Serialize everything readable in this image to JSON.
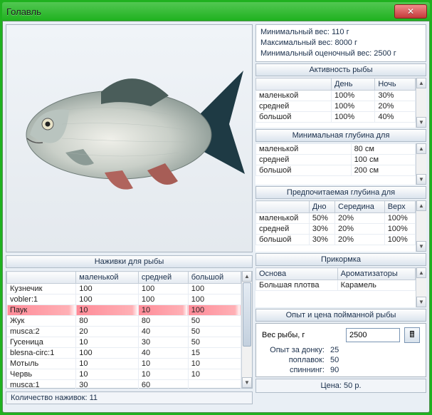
{
  "window": {
    "title": "Голавль"
  },
  "weights": {
    "min_label": "Минимальный вес:",
    "min_value": "110 г",
    "max_label": "Максимальный вес:",
    "max_value": "8000 г",
    "min_est_label": "Минимальный оценочный вес:",
    "min_est_value": "2500 г"
  },
  "activity": {
    "heading": "Активность рыбы",
    "col_day": "День",
    "col_night": "Ночь",
    "rows": [
      {
        "label": "маленькой",
        "day": "100%",
        "night": "30%"
      },
      {
        "label": "средней",
        "day": "100%",
        "night": "20%"
      },
      {
        "label": "большой",
        "day": "100%",
        "night": "40%"
      }
    ]
  },
  "min_depth": {
    "heading": "Минимальная глубина для",
    "rows": [
      {
        "label": "маленькой",
        "value": "80 см"
      },
      {
        "label": "средней",
        "value": "100 см"
      },
      {
        "label": "большой",
        "value": "200 см"
      }
    ]
  },
  "pref_depth": {
    "heading": "Предпочитаемая глубина для",
    "col1": "Дно",
    "col2": "Середина",
    "col3": "Верх",
    "rows": [
      {
        "label": "маленькой",
        "c1": "50%",
        "c2": "20%",
        "c3": "100%"
      },
      {
        "label": "средней",
        "c1": "30%",
        "c2": "20%",
        "c3": "100%"
      },
      {
        "label": "большой",
        "c1": "30%",
        "c2": "20%",
        "c3": "100%"
      }
    ]
  },
  "bait": {
    "heading": "Наживки для рыбы",
    "col_small": "маленькой",
    "col_med": "средней",
    "col_big": "большой",
    "rows": [
      {
        "name": "Кузнечик",
        "s": "100",
        "m": "100",
        "b": "100"
      },
      {
        "name": "vobler:1",
        "s": "100",
        "m": "100",
        "b": "100"
      },
      {
        "name": "Паук",
        "s": "10",
        "m": "10",
        "b": "100",
        "hl": true
      },
      {
        "name": "Жук",
        "s": "80",
        "m": "80",
        "b": "50"
      },
      {
        "name": "musca:2",
        "s": "20",
        "m": "40",
        "b": "50"
      },
      {
        "name": "Гусеница",
        "s": "10",
        "m": "30",
        "b": "50"
      },
      {
        "name": "blesna-circ:1",
        "s": "100",
        "m": "40",
        "b": "15"
      },
      {
        "name": "Мотыль",
        "s": "10",
        "m": "10",
        "b": "10"
      },
      {
        "name": "Червь",
        "s": "10",
        "m": "10",
        "b": "10"
      },
      {
        "name": "musca:1",
        "s": "30",
        "m": "60",
        "b": ""
      }
    ],
    "count_label": "Количество наживок:",
    "count_value": "11"
  },
  "groundbait": {
    "heading": "Прикормка",
    "col_base": "Основа",
    "col_flavor": "Ароматизаторы",
    "base": "Большая плотва",
    "flavor": "Карамель"
  },
  "exp": {
    "heading": "Опыт и цена пойманной рыбы",
    "weight_label": "Вес рыбы, г",
    "weight_value": "2500",
    "rows": [
      {
        "k": "Опыт за донку:",
        "v": "25"
      },
      {
        "k": "поплавок:",
        "v": "50"
      },
      {
        "k": "спиннинг:",
        "v": "90"
      }
    ],
    "price_label": "Цена:",
    "price_value": "50 р."
  }
}
